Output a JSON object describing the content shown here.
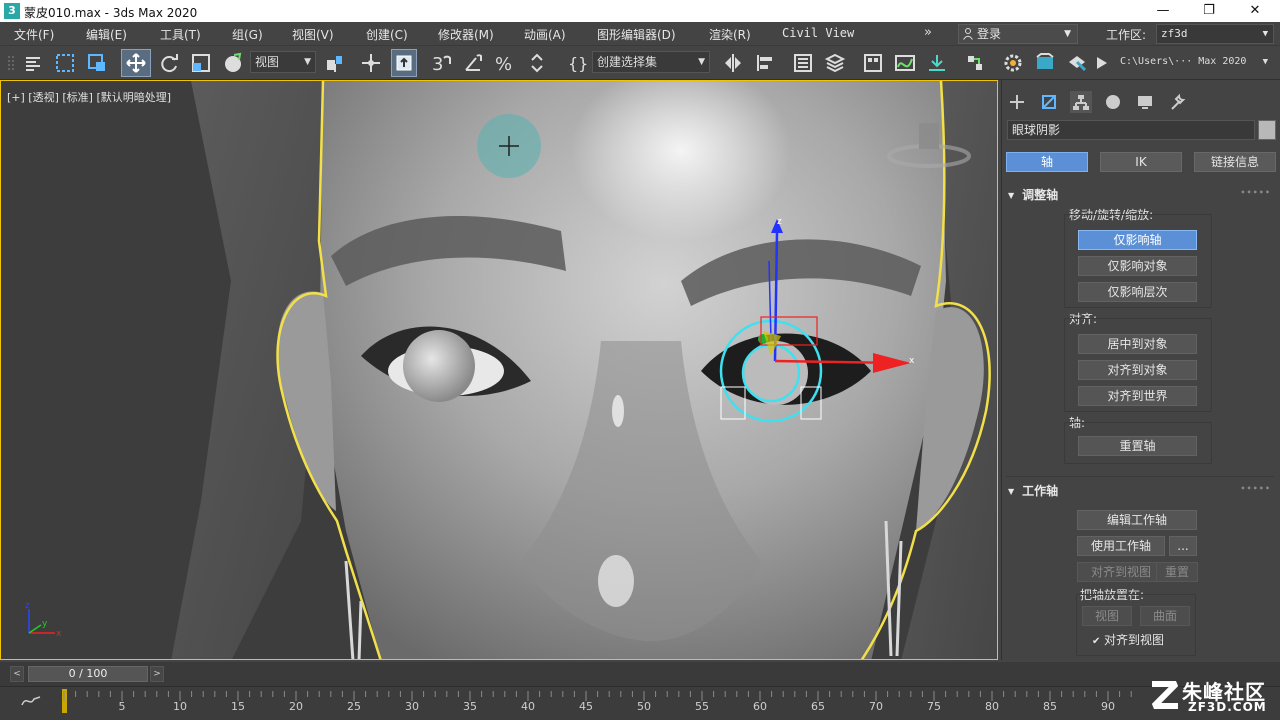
{
  "window": {
    "title": "蒙皮010.max - 3ds Max 2020",
    "app_icon": "3",
    "controls": {
      "minimize": "—",
      "maximize": "❐",
      "close": "✕"
    }
  },
  "menu": {
    "items": [
      "文件(F)",
      "编辑(E)",
      "工具(T)",
      "组(G)",
      "视图(V)",
      "创建(C)",
      "修改器(M)",
      "动画(A)",
      "图形编辑器(D)",
      "渲染(R)",
      "Civil View"
    ],
    "more": "»",
    "login": "登录",
    "workspace_label": "工作区:",
    "workspace_value": "zf3d"
  },
  "toolbar": {
    "view_dropdown": "视图",
    "selection_set": "创建选择集",
    "project_path": "C:\\Users\\··· Max 2020"
  },
  "viewport": {
    "label": "[+] [透视] [标准] [默认明暗处理]",
    "axis_labels": {
      "x": "x",
      "y": "y",
      "z": "z"
    }
  },
  "command_panel": {
    "object_name": "眼球阴影",
    "tabs": [
      "轴",
      "IK",
      "链接信息"
    ],
    "adjust_pivot": {
      "title": "调整轴",
      "move_rotate_scale_label": "移动/旋转/缩放:",
      "affect_pivot_only": "仅影响轴",
      "affect_object_only": "仅影响对象",
      "affect_hierarchy_only": "仅影响层次",
      "align_label": "对齐:",
      "center_to_object": "居中到对象",
      "align_to_object": "对齐到对象",
      "align_to_world": "对齐到世界",
      "pivot_label": "轴:",
      "reset_pivot": "重置轴"
    },
    "working_pivot": {
      "title": "工作轴",
      "edit_working_pivot": "编辑工作轴",
      "use_working_pivot": "使用工作轴",
      "ellipsis": "...",
      "align_to_view": "对齐到视图",
      "reset": "重置",
      "place_pivot_label": "把轴放置在:",
      "view": "视图",
      "surface": "曲面",
      "align_to_view_check": "对齐到视图"
    }
  },
  "timeline": {
    "frame_display": "0 / 100",
    "ticks": [
      "0",
      "5",
      "10",
      "15",
      "20",
      "25",
      "30",
      "35",
      "40",
      "45",
      "50",
      "55",
      "60",
      "65",
      "70",
      "75",
      "80",
      "85",
      "90"
    ]
  },
  "watermark": {
    "name": "朱峰社区",
    "url": "ZF3D.COM"
  },
  "colors": {
    "accent": "#5b8fd6",
    "selection_outline": "#f2e04a",
    "gizmo_cyan": "#3fe0f0"
  }
}
